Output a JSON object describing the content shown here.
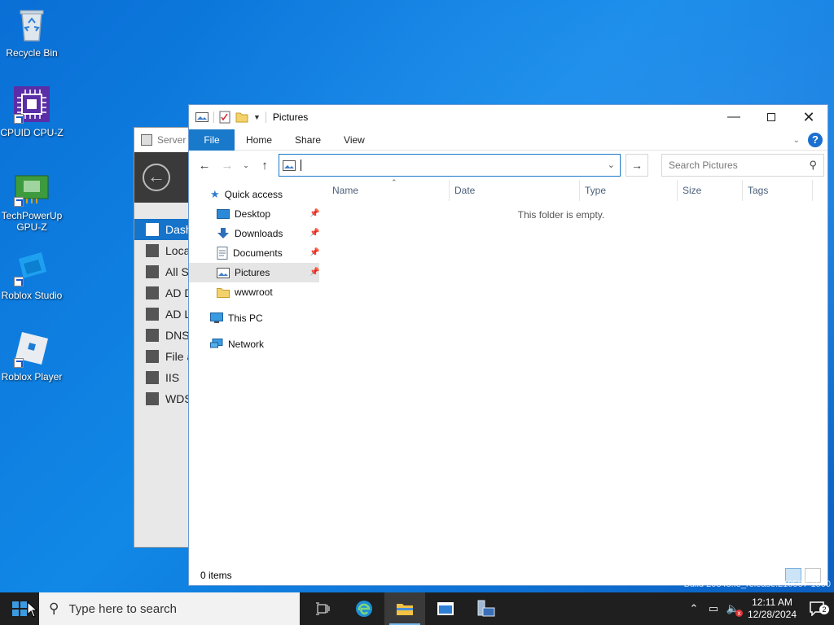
{
  "desktop": {
    "icons": [
      {
        "label": "Recycle Bin"
      },
      {
        "label": "CPUID CPU-Z"
      },
      {
        "label": "TechPowerUp GPU-Z"
      },
      {
        "label": "Roblox Studio"
      },
      {
        "label": "Roblox Player"
      }
    ],
    "build_text": "Build 20348.fe_release.210507-1500"
  },
  "server_manager": {
    "title": "Server M",
    "nav_items": [
      {
        "label": "Dash",
        "active": true
      },
      {
        "label": "Loca"
      },
      {
        "label": "All S"
      },
      {
        "label": "AD D"
      },
      {
        "label": "AD L"
      },
      {
        "label": "DNS"
      },
      {
        "label": "File a"
      },
      {
        "label": "IIS"
      },
      {
        "label": "WDS"
      }
    ]
  },
  "explorer": {
    "title": "Pictures",
    "ribbon_tabs": {
      "file": "File",
      "home": "Home",
      "share": "Share",
      "view": "View"
    },
    "address_value": "",
    "search_placeholder": "Search Pictures",
    "nav": {
      "quick_access": "Quick access",
      "desktop": "Desktop",
      "downloads": "Downloads",
      "documents": "Documents",
      "pictures": "Pictures",
      "wwwroot": "wwwroot",
      "this_pc": "This PC",
      "network": "Network"
    },
    "columns": {
      "name": "Name",
      "date": "Date",
      "type": "Type",
      "size": "Size",
      "tags": "Tags"
    },
    "empty_message": "This folder is empty.",
    "status_items": "0 items"
  },
  "taskbar": {
    "search_placeholder": "Type here to search",
    "time": "12:11 AM",
    "date": "12/28/2024",
    "notification_count": "2"
  },
  "colors": {
    "accent": "#1979ca",
    "taskbar": "#1f1f1f",
    "desktop": "#0f7ddb"
  }
}
